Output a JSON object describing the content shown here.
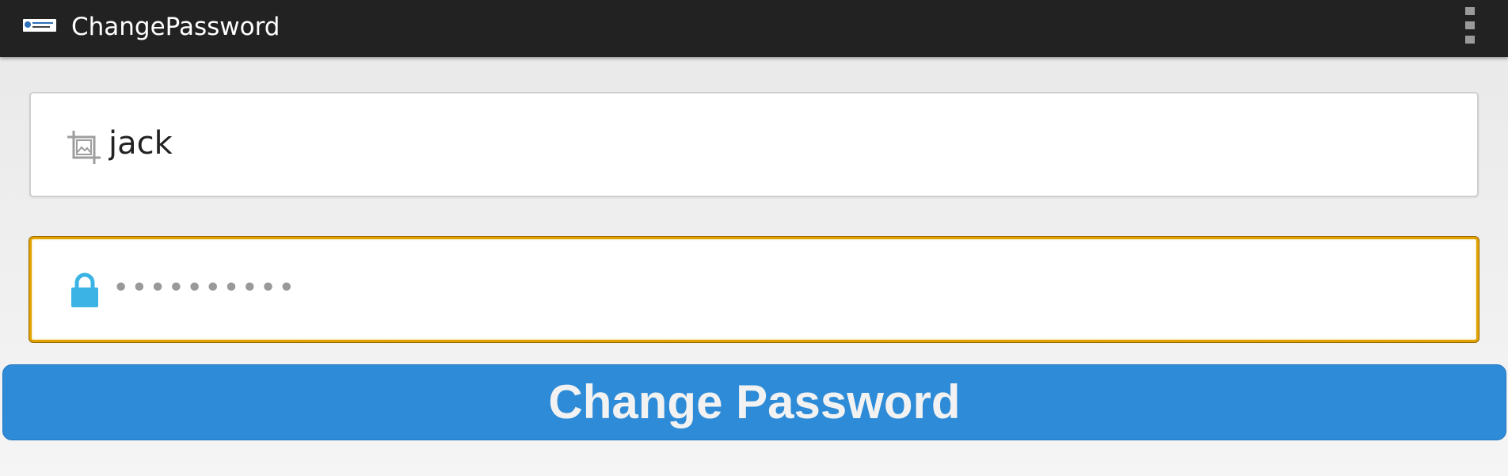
{
  "actionbar": {
    "title": "ChangePassword",
    "logo_icon": "app-logo-icon",
    "menu_icon": "overflow-menu-icon"
  },
  "form": {
    "username": {
      "value": "jack",
      "icon": "crop-image-icon"
    },
    "password": {
      "value": "••••••••••",
      "icon": "lock-icon",
      "focused": true,
      "focus_color": "#e0a300"
    },
    "submit_label": "Change Password"
  },
  "colors": {
    "actionbar": "#222222",
    "button": "#2e8bd7",
    "lock_icon": "#3bb3e4"
  }
}
